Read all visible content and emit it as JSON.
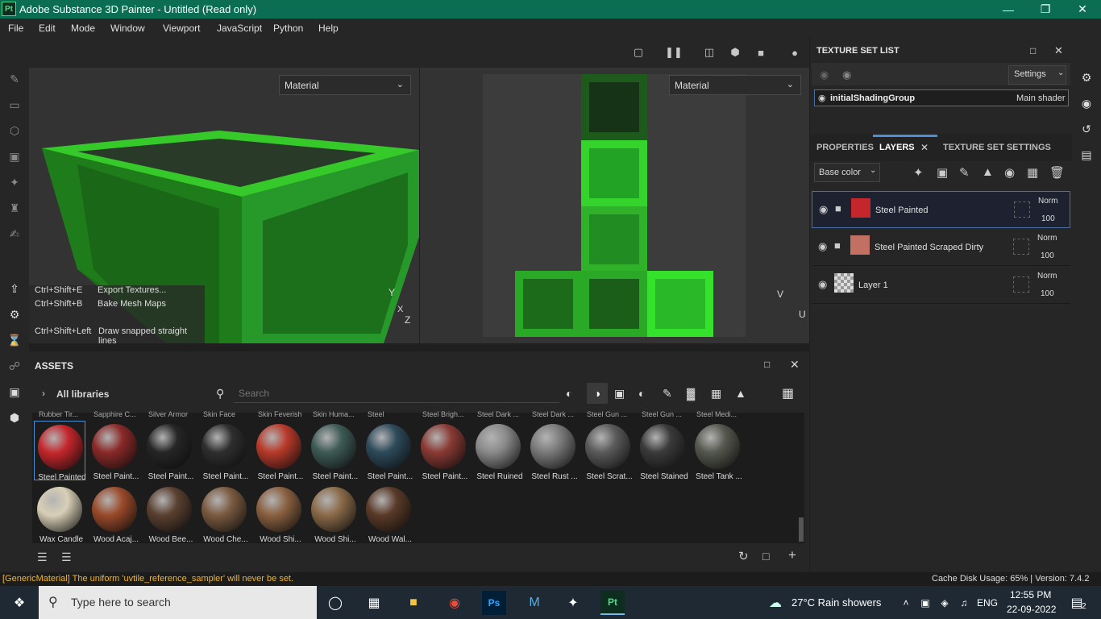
{
  "window": {
    "title": "Adobe Substance 3D Painter - Untitled (Read only)",
    "logo": "Pt"
  },
  "menu": [
    "File",
    "Edit",
    "Mode",
    "Window",
    "Viewport",
    "JavaScript",
    "Python",
    "Help"
  ],
  "viewport": {
    "left_material": "Material",
    "right_material": "Material",
    "axis_y": "Y",
    "axis_x": "X",
    "axis_z": "Z",
    "uv_v": "V",
    "uv_u": "U",
    "shortcuts": [
      {
        "keys": "Ctrl+Shift+E",
        "action": "Export Textures..."
      },
      {
        "keys": "Ctrl+Shift+B",
        "action": "Bake Mesh Maps"
      },
      {
        "keys": "Ctrl+Shift+Left",
        "action": "Draw snapped straight lines"
      }
    ]
  },
  "assets": {
    "title": "ASSETS",
    "breadcrumb": "All libraries",
    "search_placeholder": "Search",
    "top_row_labels": [
      "Rubber Tir...",
      "Sapphire C...",
      "Silver Armor",
      "Skin Face",
      "Skin Feverish",
      "Skin Huma...",
      "Steel",
      "Steel Brigh...",
      "Steel Dark ...",
      "Steel Dark ...",
      "Steel Gun ...",
      "Steel Gun ...",
      "Steel Medi..."
    ],
    "row1": [
      {
        "label": "Steel Painted",
        "color": "#c4262b"
      },
      {
        "label": "Steel Paint...",
        "color": "#8a2a28"
      },
      {
        "label": "Steel Paint...",
        "color": "#262626"
      },
      {
        "label": "Steel Paint...",
        "color": "#2e2e2e"
      },
      {
        "label": "Steel Paint...",
        "color": "#b83a2a"
      },
      {
        "label": "Steel Paint...",
        "color": "#3e5a55"
      },
      {
        "label": "Steel Paint...",
        "color": "#2d4a5a"
      },
      {
        "label": "Steel Paint...",
        "color": "#8a3a34"
      },
      {
        "label": "Steel Ruined",
        "color": "#8a8a8a"
      },
      {
        "label": "Steel Rust ...",
        "color": "#7a7a7a"
      },
      {
        "label": "Steel Scrat...",
        "color": "#5a5a5a"
      },
      {
        "label": "Steel Stained",
        "color": "#3a3a3a"
      },
      {
        "label": "Steel Tank ...",
        "color": "#55584e"
      }
    ],
    "row2": [
      {
        "label": "Wax Candle",
        "color": "#d8cfb6"
      },
      {
        "label": "Wood Acaj...",
        "color": "#9a4a2a"
      },
      {
        "label": "Wood Bee...",
        "color": "#5a4030"
      },
      {
        "label": "Wood Che...",
        "color": "#7a5a40"
      },
      {
        "label": "Wood Shi...",
        "color": "#8a6040"
      },
      {
        "label": "Wood Shi...",
        "color": "#8a6a48"
      },
      {
        "label": "Wood Wal...",
        "color": "#5a3a28"
      }
    ]
  },
  "texture_set_list": {
    "title": "TEXTURE SET LIST",
    "settings": "Settings",
    "item": "initialShadingGroup",
    "shader": "Main shader"
  },
  "tabs": {
    "properties": "PROPERTIES",
    "layers": "LAYERS",
    "texture_set_settings": "TEXTURE SET SETTINGS"
  },
  "layers": {
    "channel": "Base color",
    "items": [
      {
        "name": "Steel Painted",
        "blend": "Norm",
        "opacity": "100"
      },
      {
        "name": "Steel Painted Scraped Dirty",
        "blend": "Norm",
        "opacity": "100"
      },
      {
        "name": "Layer 1",
        "blend": "Norm",
        "opacity": "100"
      }
    ]
  },
  "status": {
    "message": "[GenericMaterial] The uniform 'uvtile_reference_sampler' will never be set.",
    "cache": "Cache Disk Usage:   65% | Version: 7.4.2",
    "message_color": "#f0b429"
  },
  "taskbar": {
    "search_placeholder": "Type here to search",
    "weather": "27°C  Rain showers",
    "lang": "ENG",
    "time": "12:55 PM",
    "date": "22-09-2022",
    "notif": "2"
  }
}
